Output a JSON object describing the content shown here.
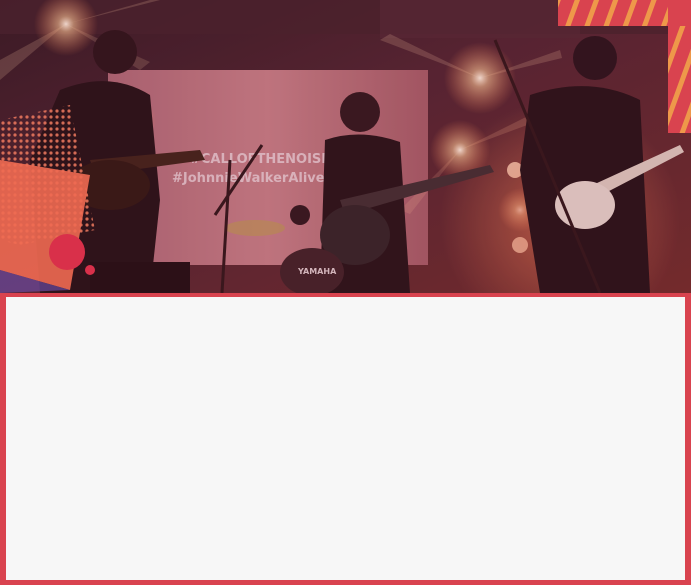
{
  "hero": {
    "screen_line_1": "#CALLOFTHENOISE",
    "screen_line_2": "#JohnnieWalkerAlive",
    "drum_brand": "YAMAHA"
  },
  "colors": {
    "accent_red": "#d9434f",
    "accent_coral": "#ef6a52",
    "accent_orange": "#f0a24a",
    "stage_dark": "#3a1b26",
    "panel_bg": "#f7f7f7"
  },
  "icons": {
    "pattern_top_right": "diagonal-stripe-pattern",
    "pattern_left": "halftone-dot-pattern",
    "decor_circle": "circle-shape"
  }
}
